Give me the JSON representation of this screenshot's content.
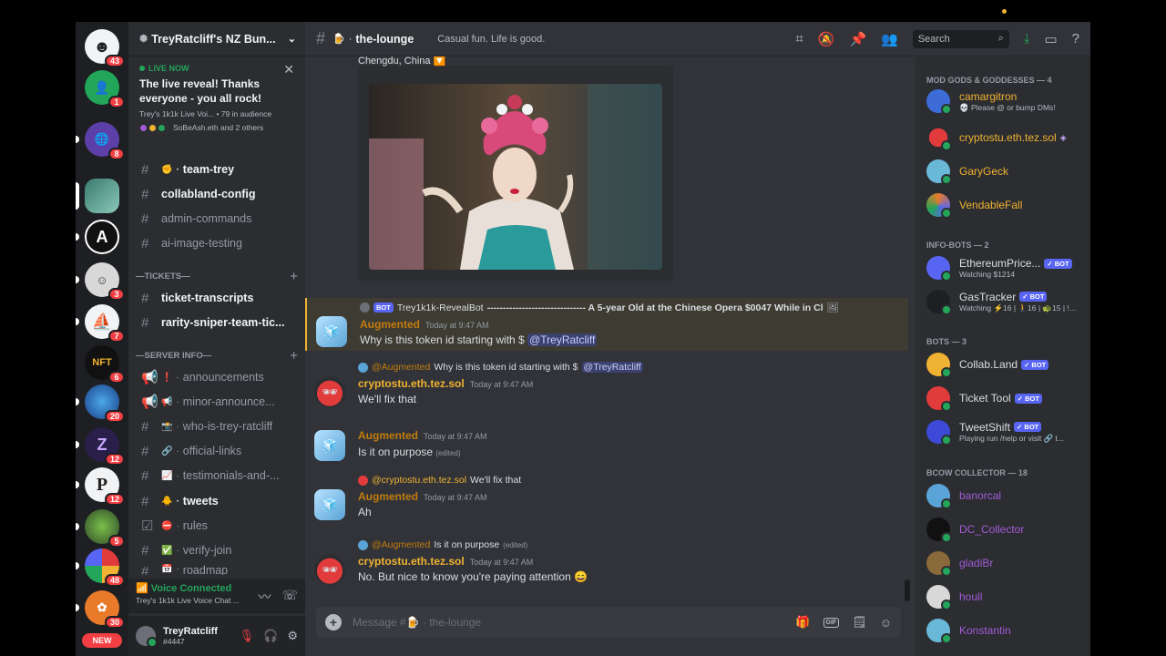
{
  "rail": {
    "servers": [
      {
        "badge": "43",
        "icon": "discord-logo-icon",
        "color": "#f2f3f5",
        "glyph": "☻"
      },
      {
        "badge": "1",
        "icon": "friends-icon",
        "color": "#23a55a",
        "glyph": "👤"
      },
      {
        "badge": "8",
        "icon": "globe-icon",
        "color": "#5c3fa8",
        "glyph": "🌐"
      },
      {
        "badge": "",
        "icon": "server-image-icon",
        "color": "#3a7a6e",
        "glyph": ""
      },
      {
        "badge": "",
        "icon": "letter-a-icon",
        "color": "#111",
        "glyph": "A"
      },
      {
        "badge": "3",
        "icon": "portrait-icon",
        "color": "#d8d8d8",
        "glyph": ""
      },
      {
        "badge": "7",
        "icon": "ship-icon",
        "color": "#f2f3f5",
        "glyph": "⛵"
      },
      {
        "badge": "6",
        "icon": "nft-icon",
        "color": "#111",
        "glyph": "NFT"
      },
      {
        "badge": "20",
        "icon": "planet-icon",
        "color": "#1c5fa8",
        "glyph": ""
      },
      {
        "badge": "12",
        "icon": "letter-z-icon",
        "color": "#2a1e4a",
        "glyph": "Z"
      },
      {
        "badge": "12",
        "icon": "letter-p-icon",
        "color": "#f2f3f5",
        "glyph": "P"
      },
      {
        "badge": "5",
        "icon": "yoda-icon",
        "color": "#2e4a2a",
        "glyph": ""
      },
      {
        "badge": "48",
        "icon": "balloons-icon",
        "color": "#f2f3f5",
        "glyph": ""
      },
      {
        "badge": "30",
        "icon": "orange-logo-icon",
        "color": "#e87a2a",
        "glyph": ""
      }
    ],
    "new_label": "NEW"
  },
  "guild": {
    "name": "TreyRatcliff's NZ Bun..."
  },
  "live": {
    "tag": "LIVE NOW",
    "title": "The live reveal! Thanks everyone - you all rock!",
    "meta": "Trey's 1k1k Live Voi... • 79 in audience",
    "who": "SoBeAsh.eth and 2 others"
  },
  "channels": {
    "top": [
      {
        "name": "team-trey",
        "emoji": "✊",
        "unread": true
      },
      {
        "name": "collabland-config",
        "emoji": "",
        "unread": true
      },
      {
        "name": "admin-commands",
        "emoji": "",
        "unread": false
      },
      {
        "name": "ai-image-testing",
        "emoji": "",
        "unread": false
      }
    ],
    "tickets_cat": "—TICKETS—",
    "tickets": [
      {
        "name": "ticket-transcripts",
        "unread": true
      },
      {
        "name": "rarity-sniper-team-tic...",
        "unread": true
      }
    ],
    "info_cat": "—SERVER INFO—",
    "info": [
      {
        "name": "announcements",
        "emoji": "❗",
        "unread": false
      },
      {
        "name": "minor-announce...",
        "emoji": "📢",
        "unread": false
      },
      {
        "name": "who-is-trey-ratcliff",
        "emoji": "📸",
        "unread": false
      },
      {
        "name": "official-links",
        "emoji": "🔗",
        "unread": false
      },
      {
        "name": "testimonials-and-...",
        "emoji": "📈",
        "unread": false
      },
      {
        "name": "tweets",
        "emoji": "🐥",
        "unread": true
      },
      {
        "name": "rules",
        "emoji": "⛔",
        "unread": false
      },
      {
        "name": "verify-join",
        "emoji": "✅",
        "unread": false
      },
      {
        "name": "roadmap",
        "emoji": "📅",
        "unread": false
      }
    ]
  },
  "voice": {
    "status": "Voice Connected",
    "channel": "Trey's 1k1k Live Voice Chat ..."
  },
  "user": {
    "name": "TreyRatcliff",
    "tag": "#4447"
  },
  "header": {
    "channel": "the-lounge",
    "emoji": "🍺",
    "topic": "Casual fun. Life is good.",
    "search_placeholder": "Search"
  },
  "image_caption": "Chengdu, China 🔽",
  "messages": [
    {
      "reply_author": "Trey1k1k-RevealBot",
      "reply_bot": "BOT",
      "reply_text": "------------------------------- A 5-year Old at the Chinese Opera $0047 While in Cl",
      "author": "Augmented",
      "time": "Today at 9:47 AM",
      "text": "Why is this token id starting with $ ",
      "mention": "@TreyRatcliff"
    },
    {
      "reply_author": "@Augmented",
      "reply_text": "Why is this token id starting with $ ",
      "reply_mention": "@TreyRatcliff",
      "author": "cryptostu.eth.tez.sol",
      "time": "Today at 9:47 AM",
      "text": "We'll fix that"
    },
    {
      "author": "Augmented",
      "time": "Today at 9:47 AM",
      "text": "Is it on purpose",
      "edited": "(edited)"
    },
    {
      "reply_author": "@cryptostu.eth.tez.sol",
      "reply_text": "We'll fix that",
      "author": "Augmented",
      "time": "Today at 9:47 AM",
      "text": "Ah"
    },
    {
      "reply_author": "@Augmented",
      "reply_text": "Is it on purpose",
      "reply_edited": "(edited)",
      "author": "cryptostu.eth.tez.sol",
      "time": "Today at 9:47 AM",
      "text": "No. But nice to know you're paying attention 😄"
    }
  ],
  "composer": {
    "placeholder": "Message #🍺 · the-lounge",
    "gif": "GIF"
  },
  "members": {
    "mods_cat": "MOD GODS & GODDESSES — 4",
    "mods": [
      {
        "name": "camargitron",
        "status": "💀 Please @ or bump DMs!",
        "color": "#f0b232"
      },
      {
        "name": "cryptostu.eth.tez.sol",
        "status": "",
        "color": "#f0b232"
      },
      {
        "name": "GaryGeck",
        "status": "",
        "color": "#f0b232"
      },
      {
        "name": "VendableFall",
        "status": "",
        "color": "#f0b232"
      }
    ],
    "infobots_cat": "INFO-BOTS — 2",
    "infobots": [
      {
        "name": "EthereumPrice...",
        "bot": "✓ BOT",
        "status": "Watching $1214"
      },
      {
        "name": "GasTracker",
        "bot": "✓ BOT",
        "status": "Watching ⚡16 | 🚶16 | 🐢15 | !h..."
      }
    ],
    "bots_cat": "BOTS — 3",
    "bots": [
      {
        "name": "Collab.Land",
        "bot": "✓ BOT",
        "status": ""
      },
      {
        "name": "Ticket Tool",
        "bot": "✓ BOT",
        "status": ""
      },
      {
        "name": "TweetShift",
        "bot": "✓ BOT",
        "status": "Playing run /help or visit 🔗 t..."
      }
    ],
    "bcow_cat": "BCOW COLLECTOR — 18",
    "bcow": [
      {
        "name": "banorcal",
        "color": "#a35bd8"
      },
      {
        "name": "DC_Collector",
        "color": "#a35bd8"
      },
      {
        "name": "gladiBr",
        "color": "#a35bd8"
      },
      {
        "name": "houll",
        "color": "#a35bd8"
      },
      {
        "name": "Konstantin",
        "color": "#a35bd8"
      }
    ]
  },
  "colors": {
    "augmented": "#c27c0e",
    "cryptostu": "#f0b232",
    "unread_badge": "#f23f43",
    "online": "#23a55a"
  }
}
